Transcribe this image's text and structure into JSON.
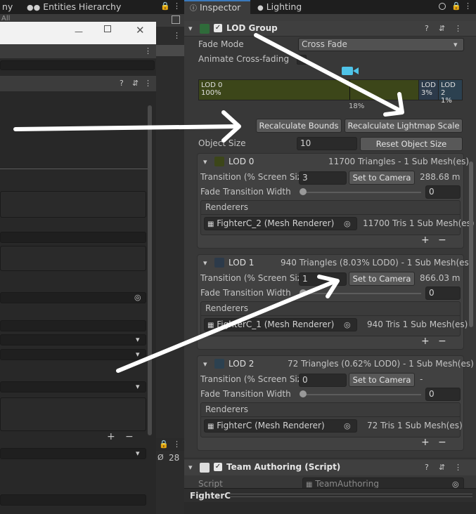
{
  "tabs": {
    "left_partial": "ny",
    "hierarchy": "Entities Hierarchy",
    "inspector": "Inspector",
    "lighting": "Lighting"
  },
  "hierarchy_search_hint": "All",
  "visibility_count": "28",
  "lod_group": {
    "title": "LOD Group",
    "fade_mode_label": "Fade Mode",
    "fade_mode_value": "Cross Fade",
    "animate_label": "Animate Cross-fading",
    "lod_bar": [
      {
        "name": "LOD 0",
        "percent": "100%",
        "color": "#3c4619"
      },
      {
        "name": "LOD",
        "percent": "3%",
        "color": "#2c3a4a"
      },
      {
        "name": "LOD 2",
        "percent": "1%",
        "color": "#2c4150"
      }
    ],
    "camera_marker": "18%",
    "recalc_bounds": "Recalculate Bounds",
    "recalc_lightmap": "Recalculate Lightmap Scale",
    "object_size_label": "Object Size",
    "object_size_value": "10",
    "reset_object_size": "Reset Object Size",
    "transition_label": "Transition (% Screen Size)",
    "fade_width_label": "Fade Transition Width",
    "set_to_camera": "Set to Camera",
    "renderers_label": "Renderers",
    "lods": [
      {
        "name": "LOD 0",
        "summary": "11700 Triangles - 1 Sub Mesh(es)",
        "swatch": "#3c4619",
        "transition": "3",
        "distance": "288.68 m",
        "fade_width": "0",
        "renderer": "FighterC_2 (Mesh Renderer)",
        "renderer_info": "11700 Tris 1 Sub Mesh(es)"
      },
      {
        "name": "LOD 1",
        "summary": "940 Triangles (8.03% LOD0) - 1 Sub Mesh(es)",
        "swatch": "#2c3a4a",
        "transition": "1",
        "distance": "866.03 m",
        "fade_width": "0",
        "renderer": "FighterC_1 (Mesh Renderer)",
        "renderer_info": "940 Tris 1 Sub Mesh(es)"
      },
      {
        "name": "LOD 2",
        "summary": "72 Triangles (0.62% LOD0) - 1 Sub Mesh(es)",
        "swatch": "#2c4150",
        "transition": "0",
        "distance": "-",
        "fade_width": "0",
        "renderer": "FighterC (Mesh Renderer)",
        "renderer_info": "72 Tris 1 Sub Mesh(es)"
      }
    ]
  },
  "team_authoring": {
    "title": "Team Authoring (Script)",
    "script_label": "Script",
    "script_value": "TeamAuthoring"
  },
  "footer_object": "FighterC",
  "icons": {
    "help": "help-icon",
    "settings": "preset-icon",
    "menu": "kebab-menu-icon",
    "lock": "lock-icon",
    "plus": "+",
    "minus": "−"
  }
}
